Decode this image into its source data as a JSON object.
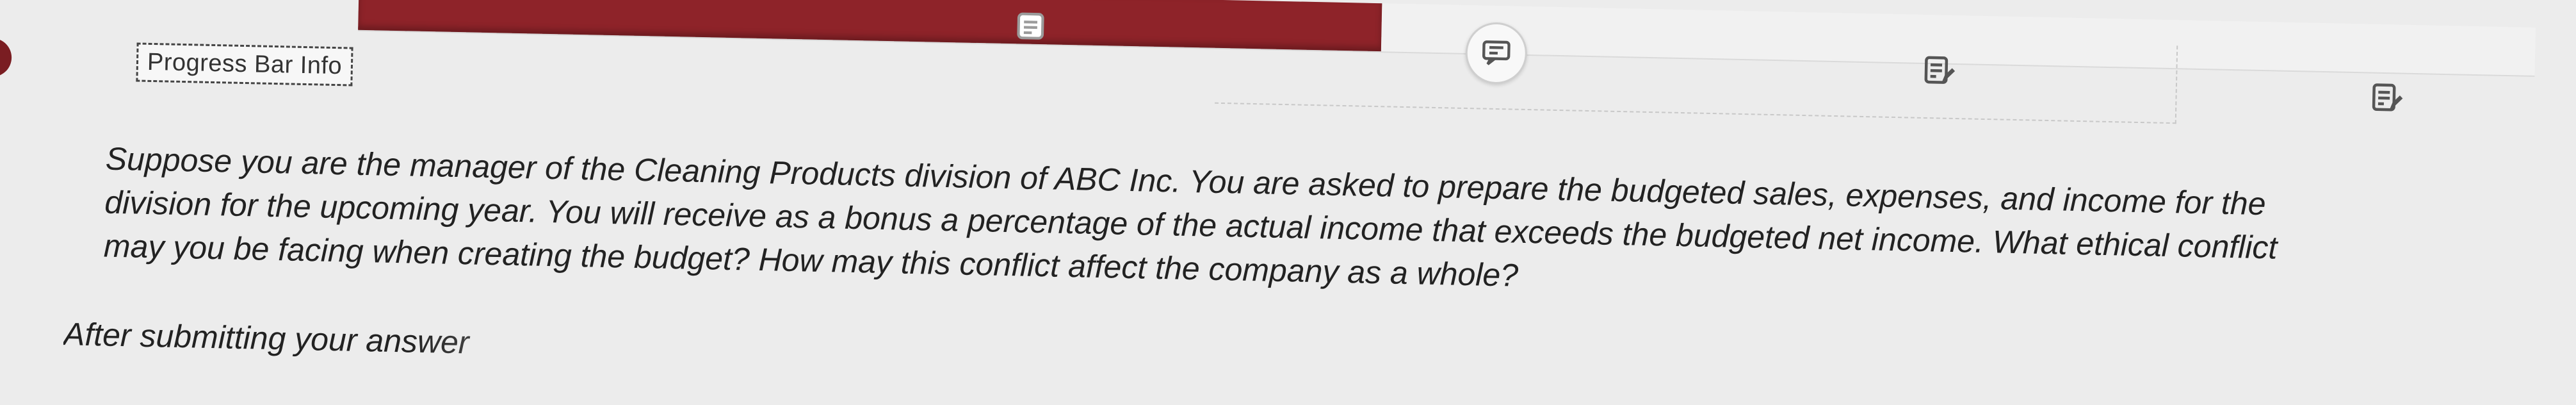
{
  "progress": {
    "completed_fraction": 0.47,
    "accent_color": "#8e2329",
    "icons": [
      "note-icon",
      "feedback-icon",
      "edit-note-icon",
      "edit-note-icon"
    ]
  },
  "info_button": {
    "label": "Progress Bar Info"
  },
  "question": {
    "lines": [
      "Suppose you are the manager of the Cleaning Products division of ABC Inc. You are asked to prepare the budgeted sales, expenses, and income for the",
      "division for the upcoming year. You will receive as a bonus a percentage of the actual income that exceeds the budgeted net income. What ethical conflict",
      "may you be facing when creating the budget? How may this conflict affect the company as a whole?"
    ],
    "after_text": "After submitting your answer"
  }
}
